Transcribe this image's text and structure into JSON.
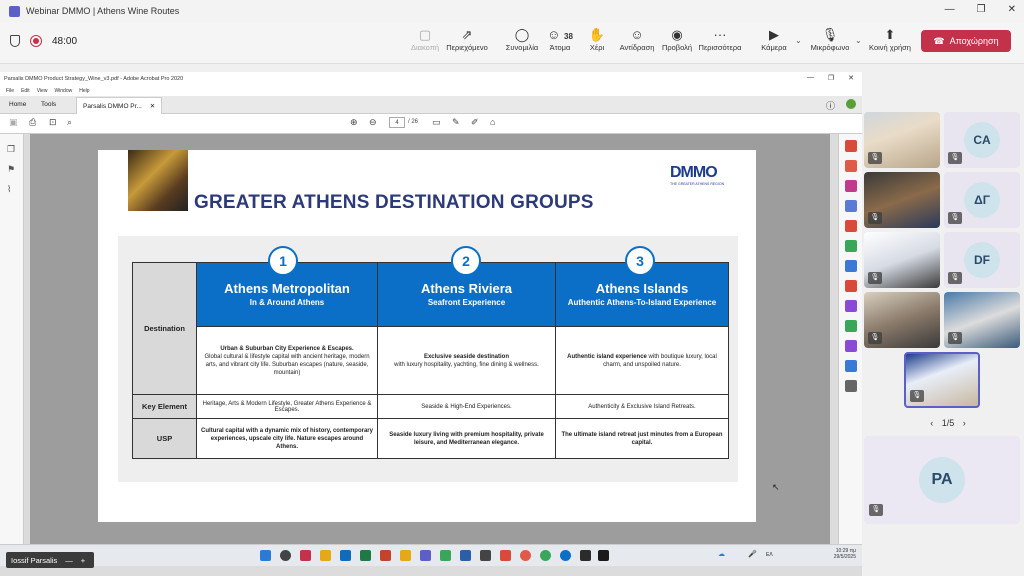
{
  "window": {
    "title": "Webinar DMMO | Athens Wine Routes"
  },
  "meeting": {
    "timer": "48:00",
    "tools": [
      {
        "label": "Διακοπή",
        "icon": "stop-share-icon",
        "glyph": "▢",
        "disabled": true
      },
      {
        "label": "Περιεχόμενο",
        "icon": "share-content-icon",
        "glyph": "⇗",
        "disabled": false
      },
      {
        "label": "Συνομιλία",
        "icon": "chat-icon",
        "glyph": "◯",
        "disabled": false
      },
      {
        "label": "Άτομα",
        "icon": "people-icon",
        "glyph": "☺",
        "disabled": false
      },
      {
        "label": "Χέρι",
        "icon": "raise-hand-icon",
        "glyph": "✋",
        "disabled": false
      },
      {
        "label": "Αντίδραση",
        "icon": "reaction-icon",
        "glyph": "☺",
        "disabled": false
      },
      {
        "label": "Προβολή",
        "icon": "view-icon",
        "glyph": "◉",
        "disabled": false
      },
      {
        "label": "Περισσότερα",
        "icon": "more-icon",
        "glyph": "···",
        "disabled": false
      },
      {
        "label": "Κάμερα",
        "icon": "camera-off-icon",
        "glyph": "▶",
        "disabled": false
      },
      {
        "label": "Μικρόφωνο",
        "icon": "mic-off-icon",
        "glyph": "🎙",
        "disabled": false
      },
      {
        "label": "Κοινή χρήση",
        "icon": "share-icon",
        "glyph": "⬆",
        "disabled": false
      }
    ],
    "people_count": "38",
    "leave_label": "Αποχώρηση",
    "leave_color": "#c4314b"
  },
  "acrobat": {
    "title": "Parsalis DMMO Product Strategy_Wine_v3.pdf - Adobe Acrobat Pro 2020",
    "menu": [
      "File",
      "Edit",
      "View",
      "Window",
      "Help"
    ],
    "tabs": [
      "Home",
      "Tools",
      "Parsalis DMMO Pr..."
    ],
    "page_current": "4",
    "page_total": "/ 26"
  },
  "slide": {
    "title": "GREATER ATHENS DESTINATION GROUPS",
    "logo_text": "DMMO",
    "logo_sub": "THE GREATER ATHENS REGION",
    "row_labels": [
      "Destination",
      "Key Element",
      "USP"
    ],
    "columns": [
      {
        "number": "1",
        "title": "Athens Metropolitan",
        "subtitle": "In & Around Athens",
        "desc_bold": "Urban & Suburban City Experience & Escapes.",
        "desc": "Global cultural & lifestyle capital with ancient heritage, modern arts, and vibrant city life. Suburban escapes (nature, seaside, mountain)",
        "key": "Heritage, Arts & Modern Lifestyle, Greater Athens Experience & Escapes.",
        "usp": "Cultural capital with a dynamic mix of history, contemporary experiences, upscale city life. Nature escapes around Athens."
      },
      {
        "number": "2",
        "title": "Athens Riviera",
        "subtitle": "Seafront Experience",
        "desc_bold": "Exclusive seaside destination",
        "desc": "with luxury hospitality, yachting, fine dining & wellness.",
        "key": "Seaside & High-End Experiences.",
        "usp": "Seaside luxury living with premium hospitality, private leisure, and Mediterranean elegance."
      },
      {
        "number": "3",
        "title": "Athens Islands",
        "subtitle": "Authentic Athens-To-Island Experience",
        "desc_bold": "Authentic island experience",
        "desc": "with boutique luxury, local charm, and unspoiled nature.",
        "key": "Authenticity & Exclusive Island Retreats.",
        "usp": "The ultimate island retreat just minutes from a European capital."
      }
    ],
    "header_color": "#0b6fc7",
    "title_color": "#2d3a7a"
  },
  "taskbar": {
    "time": "10:29 πμ",
    "date": "29/5/2025",
    "lang": "ΕΛ"
  },
  "presenter": {
    "name": "Iossif Parsalis"
  },
  "participants": {
    "initials": [
      "CA",
      "ΔΓ",
      "DF"
    ],
    "pager": "1/5",
    "large_initials": "PA"
  }
}
